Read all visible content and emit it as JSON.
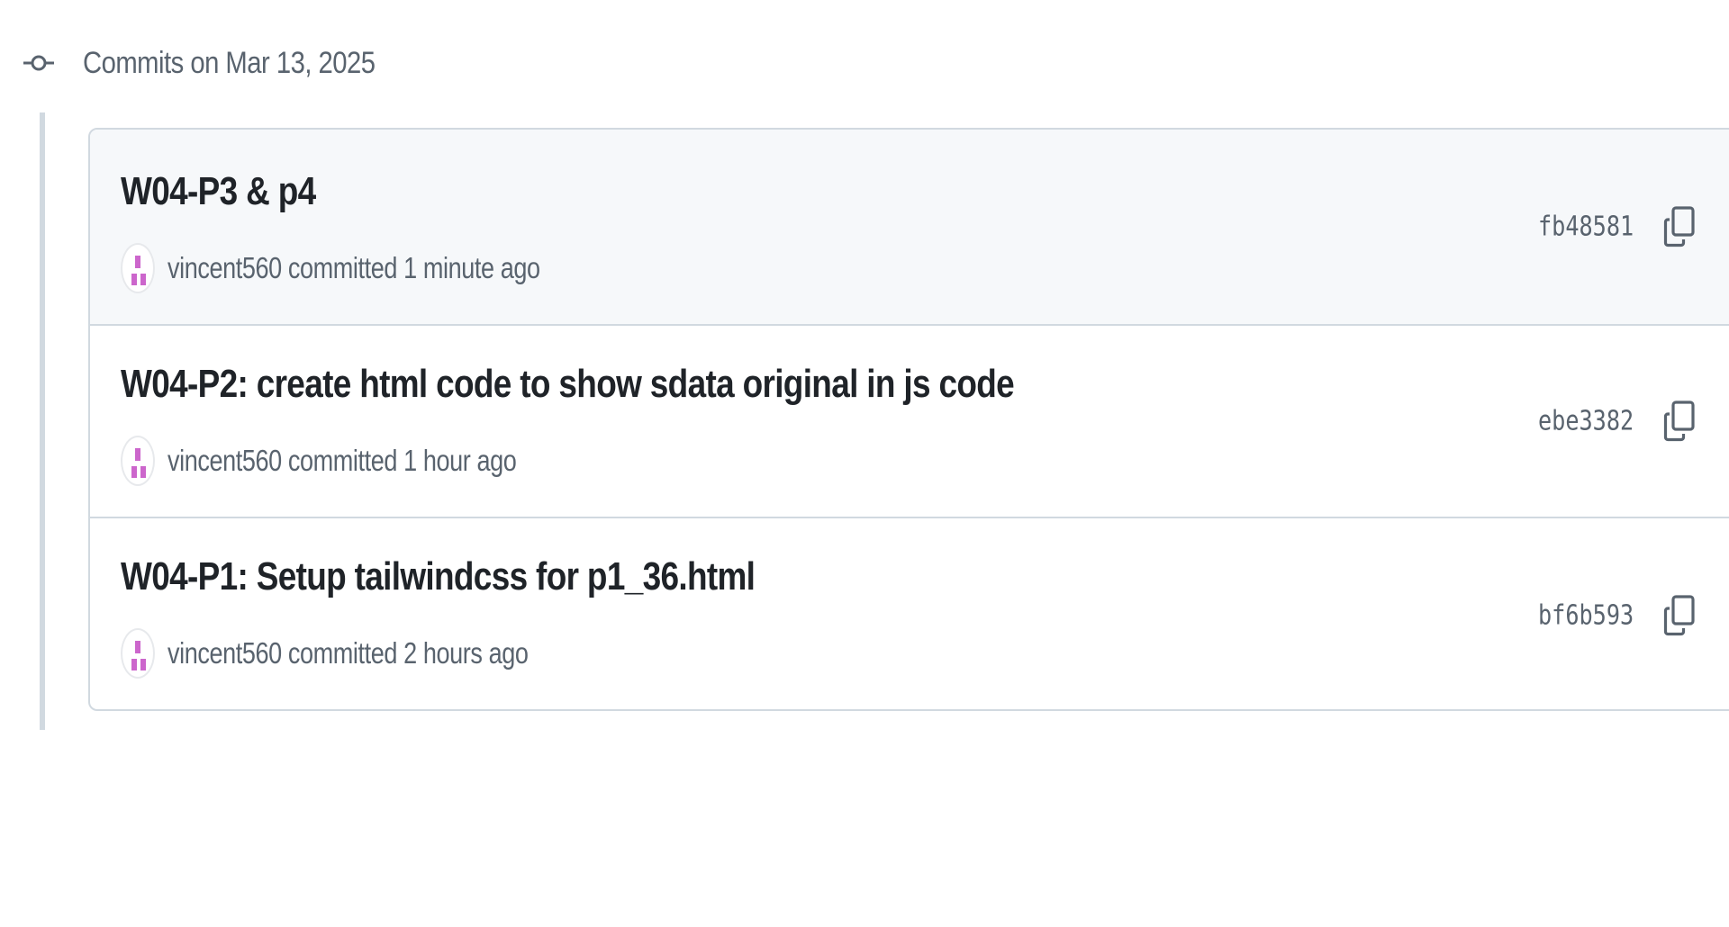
{
  "group": {
    "title": "Commits on Mar 13, 2025",
    "icon": "git-commit-icon"
  },
  "commits": [
    {
      "title": "W04-P3 & p4",
      "author": "vincent560",
      "action": "committed",
      "time": "1 minute ago",
      "sha": "fb48581"
    },
    {
      "title": "W04-P2: create html code to show sdata original in js code",
      "author": "vincent560",
      "action": "committed",
      "time": "1 hour ago",
      "sha": "ebe3382"
    },
    {
      "title": "W04-P1: Setup tailwindcss for p1_36.html",
      "author": "vincent560",
      "action": "committed",
      "time": "2 hours ago",
      "sha": "bf6b593"
    }
  ],
  "icons": {
    "copy": "copy-icon",
    "browse": "code-brackets-icon",
    "avatar": "identicon-avatar"
  },
  "colors": {
    "muted_text": "#59636e",
    "border": "#d1d9e0",
    "highlight_row": "#f6f8fa",
    "avatar_accent": "#cc66cc"
  }
}
